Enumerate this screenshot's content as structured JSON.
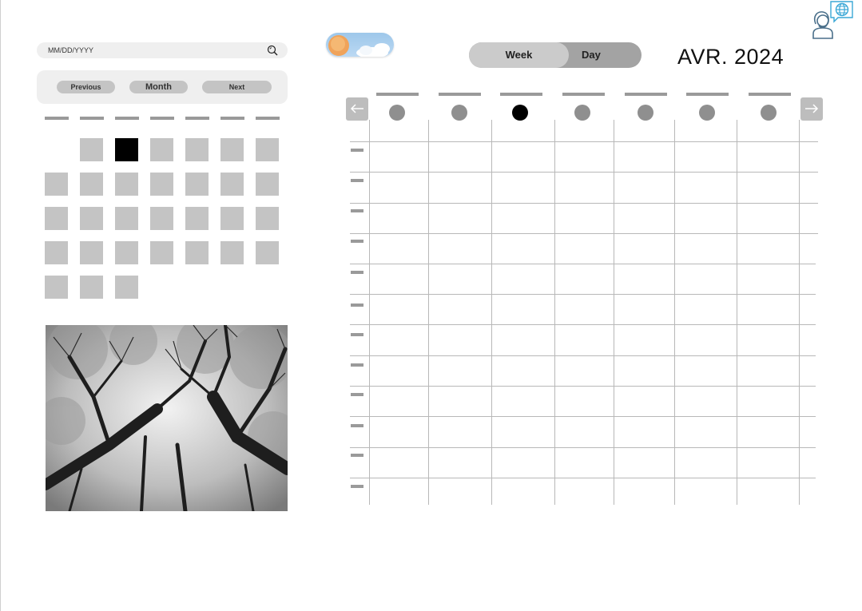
{
  "date_search": {
    "placeholder": "MM/DD/YYYY",
    "icon": "search-icon"
  },
  "mini_calendar": {
    "nav": {
      "previous": "Previous",
      "month": "Month",
      "next": "Next"
    },
    "weekday_count": 7,
    "leading_blank_days": 1,
    "days_in_month": 30,
    "selected_day": 2
  },
  "photo": {
    "subject": "black-and-white forest canopy, looking up at bare trees"
  },
  "weather_toggle": {
    "icons": [
      "sun-icon",
      "cloud-icon"
    ]
  },
  "view_toggle": {
    "week": "Week",
    "day": "Day",
    "active": "Week"
  },
  "header": {
    "month_year": "AVR. 2024"
  },
  "user_menu": {
    "icons": [
      "person-icon",
      "globe-icon"
    ]
  },
  "week_view": {
    "days": 7,
    "today_index": 2,
    "hour_rows": 12,
    "nav_icons": [
      "arrow-left-icon",
      "arrow-right-icon"
    ]
  },
  "colors": {
    "placeholder_fill": "#c4c4c4",
    "selected_fill": "#000000",
    "panel_bg": "#efefef",
    "grid_line": "#b8b8b8"
  }
}
